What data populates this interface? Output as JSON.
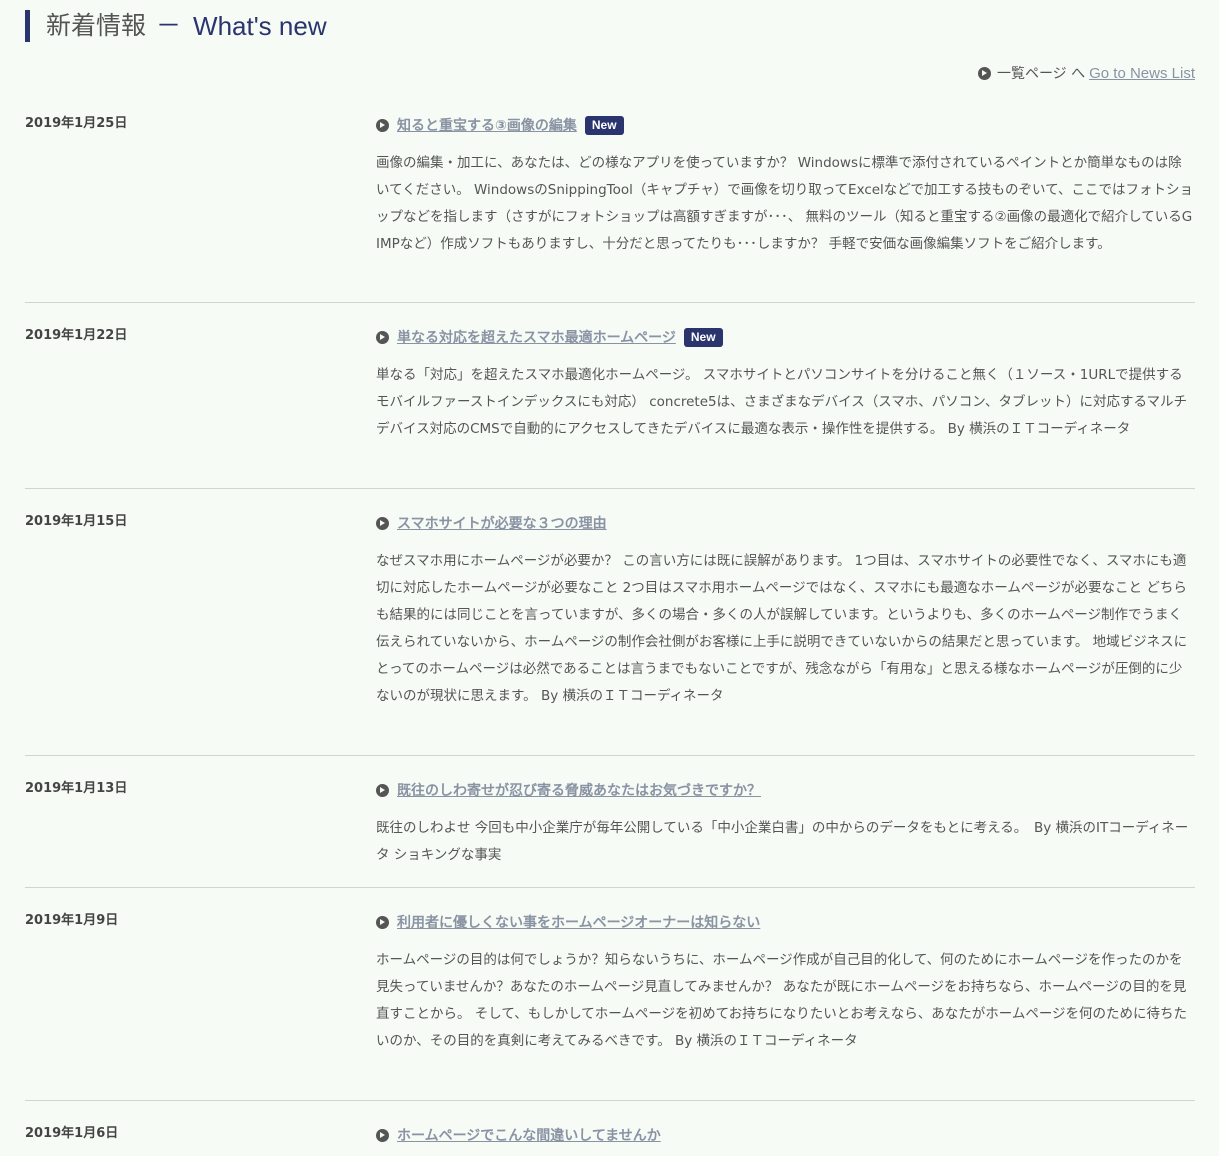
{
  "heading": {
    "ja": "新着情報",
    "separator": "－",
    "en": "What's new"
  },
  "list_link": {
    "prefix": "一覧ページ へ",
    "label": "Go to News List"
  },
  "badge_label": "New",
  "news": [
    {
      "date": "2019年1月25日",
      "title": "知ると重宝する③画像の編集",
      "is_new": true,
      "description": "画像の編集・加工に、あなたは、どの様なアプリを使っていますか？ Windowsに標準で添付されているペイントとか簡単なものは除いてください。 WindowsのSnippingTool（キャプチャ）で画像を切り取ってExcelなどで加工する技ものぞいて、ここではフォトショップなどを指します（さすがにフォトショップは高額すぎますが･･･、 無料のツール（知ると重宝する②画像の最適化で紹介しているGIMPなど）作成ソフトもありますし、十分だと思ってたりも･･･しますか？ 手軽で安価な画像編集ソフトをご紹介します。"
    },
    {
      "date": "2019年1月22日",
      "title": "単なる対応を超えたスマホ最適ホームページ",
      "is_new": true,
      "description": "単なる「対応」を超えたスマホ最適化ホームページ。 スマホサイトとパソコンサイトを分けること無く（１ソース・1URLで提供するモバイルファーストインデックスにも対応） concrete5は、さまざまなデバイス（スマホ、パソコン、タブレット）に対応するマルチデバイス対応のCMSで自動的にアクセスしてきたデバイスに最適な表示・操作性を提供する。 By 横浜のＩＴコーディネータ"
    },
    {
      "date": "2019年1月15日",
      "title": "スマホサイトが必要な３つの理由",
      "is_new": false,
      "description": "なぜスマホ用にホームページが必要か？ この言い方には既に誤解があります。 1つ目は、スマホサイトの必要性でなく、スマホにも適切に対応したホームページが必要なこと 2つ目はスマホ用ホームページではなく、スマホにも最適なホームページが必要なこと どちらも結果的には同じことを言っていますが、多くの場合・多くの人が誤解しています。というよりも、多くのホームページ制作でうまく伝えられていないから、ホームページの制作会社側がお客様に上手に説明できていないからの結果だと思っています。 地域ビジネスにとってのホームページは必然であることは言うまでもないことですが、残念ながら「有用な」と思える様なホームページが圧倒的に少ないのが現状に思えます。 By 横浜のＩＴコーディネータ"
    },
    {
      "date": "2019年1月13日",
      "title": "既往のしわ寄せが忍び寄る脅威あなたはお気づきですか？",
      "is_new": false,
      "description": "既往のしわよせ 今回も中小企業庁が毎年公開している「中小企業白書」の中からのデータをもとに考える。　By 横浜のITコーディネータ ショキングな事実"
    },
    {
      "date": "2019年1月9日",
      "title": "利用者に優しくない事をホームページオーナーは知らない",
      "is_new": false,
      "description": "ホームページの目的は何でしょうか？知らないうちに、ホームページ作成が自己目的化して、何のためにホームページを作ったのかを見失っていませんか？あなたのホームページ見直してみませんか？ あなたが既にホームページをお持ちなら、ホームページの目的を見直すことから。 そして、もしかしてホームページを初めてお持ちになりたいとお考えなら、あなたがホームページを何のために待ちたいのか、その目的を真剣に考えてみるべきです。 By 横浜のＩＴコーディネータ"
    },
    {
      "date": "2019年1月6日",
      "title": "ホームページでこんな間違いしてませんか",
      "is_new": false,
      "description": ""
    }
  ]
}
